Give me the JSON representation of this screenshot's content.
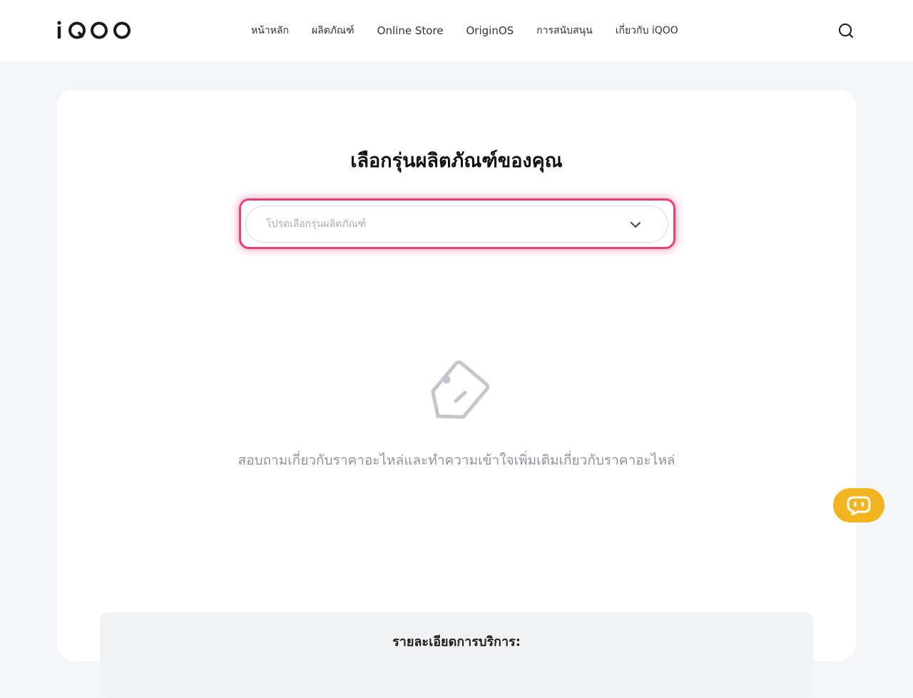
{
  "header": {
    "logo_text": "iQOO",
    "nav": [
      {
        "label": "หน้าหลัก"
      },
      {
        "label": "ผลิตภัณฑ์"
      },
      {
        "label": "Online Store"
      },
      {
        "label": "OriginOS"
      },
      {
        "label": "การสนับสนุน"
      },
      {
        "label": "เกี่ยวกับ iQOO"
      }
    ],
    "search_icon": "search-icon"
  },
  "main": {
    "title": "เลือกรุ่นผลิตภัณฑ์ของคุณ",
    "select": {
      "placeholder": "โปรดเลือกรุ่นผลิตภัณฑ์",
      "icon": "chevron-down-icon"
    },
    "empty_state": {
      "icon": "price-tag-icon",
      "text": "สอบถามเกี่ยวกับราคาอะไหล่และทำความเข้าใจเพิ่มเติมเกี่ยวกับราคาอะไหล่"
    },
    "details": {
      "title": "รายละเอียดการบริการ:"
    }
  },
  "chat": {
    "icon": "chatbot-icon"
  },
  "colors": {
    "accent_highlight": "#ec3e74",
    "chat_button": "#f2b51f",
    "page_background": "#f4f6fa"
  }
}
